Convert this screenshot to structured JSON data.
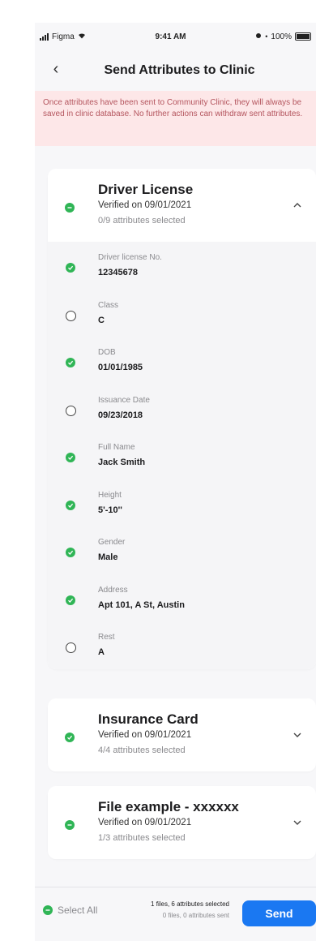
{
  "status_bar": {
    "carrier": "Figma",
    "time": "9:41 AM",
    "battery": "100%"
  },
  "header": {
    "title": "Send Attributes to Clinic"
  },
  "warning": {
    "text": "Once attributes have been sent to Community Clinic, they will always be saved in clinic database. No further actions can withdraw sent attributes."
  },
  "colors": {
    "check_green": "#30b556",
    "send_blue": "#1a78f2",
    "warning_bg": "#fde7e8",
    "warning_text": "#b4555e"
  },
  "cards": [
    {
      "title": "Driver License",
      "verified": "Verified on 09/01/2021",
      "count": "0/9 attributes selected",
      "expanded": true,
      "attributes": [
        {
          "label": "Driver license No.",
          "value": "12345678",
          "selected": true
        },
        {
          "label": "Class",
          "value": "C",
          "selected": false
        },
        {
          "label": "DOB",
          "value": "01/01/1985",
          "selected": true
        },
        {
          "label": "Issuance Date",
          "value": "09/23/2018",
          "selected": false
        },
        {
          "label": "Full Name",
          "value": "Jack Smith",
          "selected": true
        },
        {
          "label": "Height",
          "value": "5'-10''",
          "selected": true
        },
        {
          "label": "Gender",
          "value": "Male",
          "selected": true
        },
        {
          "label": "Address",
          "value": "Apt 101, A St, Austin",
          "selected": true
        },
        {
          "label": "Rest",
          "value": "A",
          "selected": false
        }
      ]
    },
    {
      "title": "Insurance Card",
      "verified": "Verified on 09/01/2021",
      "count": "4/4 attributes selected",
      "expanded": false
    },
    {
      "title": "File example - xxxxxx",
      "verified": "Verified on 09/01/2021",
      "count": "1/3 attributes selected",
      "expanded": false
    }
  ],
  "footer": {
    "select_all": "Select All",
    "summary_main": "1 files, 6 attributes selected",
    "summary_sub": "0 files, 0 attributes sent",
    "send": "Send"
  }
}
